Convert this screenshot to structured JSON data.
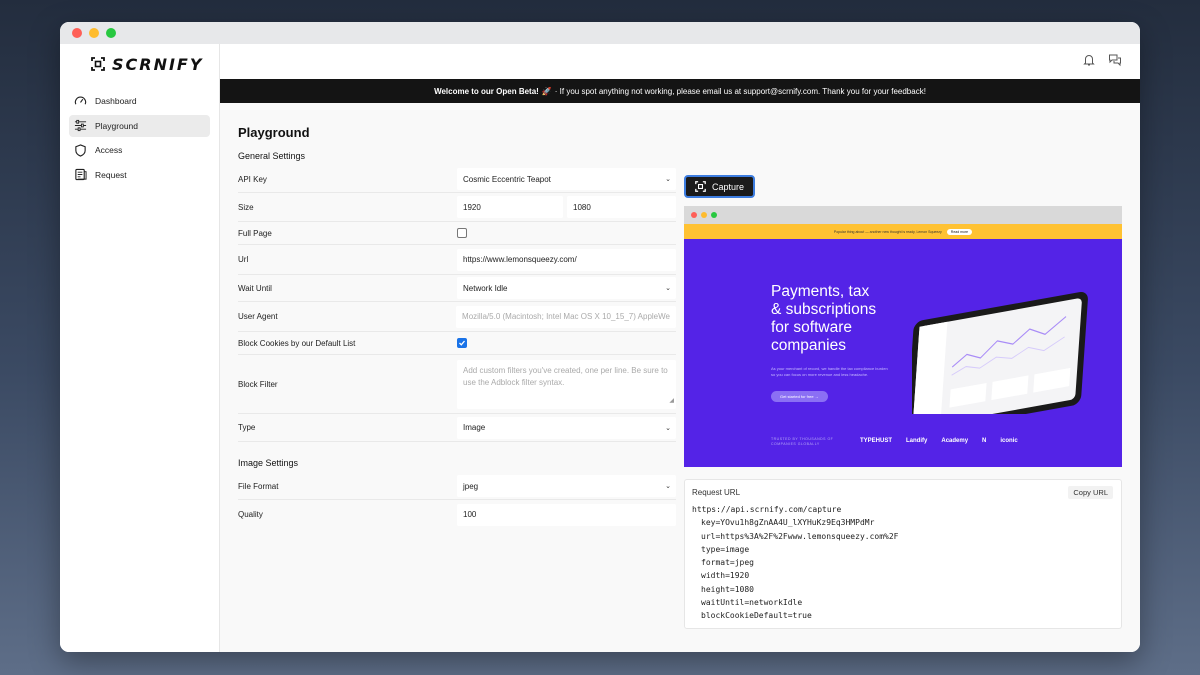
{
  "brand": {
    "name": "SCRNIFY"
  },
  "sidebar": {
    "items": [
      {
        "label": "Dashboard",
        "icon": "gauge-icon"
      },
      {
        "label": "Playground",
        "icon": "sliders-icon",
        "active": true
      },
      {
        "label": "Access",
        "icon": "shield-icon"
      },
      {
        "label": "Request",
        "icon": "scroll-icon"
      }
    ]
  },
  "topbar": {
    "icons": [
      "bell-icon",
      "chat-icon"
    ]
  },
  "banner": {
    "bold": "Welcome to our Open Beta!",
    "emoji": "🚀",
    "text": "· If you spot anything not working, please email us at support@scrnify.com. Thank you for your feedback!"
  },
  "page": {
    "title": "Playground"
  },
  "general": {
    "title": "General Settings",
    "api_key": {
      "label": "API Key",
      "value": "Cosmic Eccentric Teapot"
    },
    "size": {
      "label": "Size",
      "width": "1920",
      "height": "1080"
    },
    "full_page": {
      "label": "Full Page",
      "checked": false
    },
    "url": {
      "label": "Url",
      "value": "https://www.lemonsqueezy.com/"
    },
    "wait_until": {
      "label": "Wait Until",
      "value": "Network Idle"
    },
    "user_agent": {
      "label": "User Agent",
      "placeholder": "Mozilla/5.0 (Macintosh; Intel Mac OS X 10_15_7) AppleWe"
    },
    "block_cookies": {
      "label": "Block Cookies by our Default List",
      "checked": true
    },
    "block_filter": {
      "label": "Block Filter",
      "placeholder": "Add custom filters you've created, one per line. Be sure to use the Adblock filter syntax."
    },
    "type": {
      "label": "Type",
      "value": "Image"
    }
  },
  "image": {
    "title": "Image Settings",
    "file_format": {
      "label": "File Format",
      "value": "jpeg"
    },
    "quality": {
      "label": "Quality",
      "value": "100"
    }
  },
  "capture": {
    "label": "Capture"
  },
  "preview": {
    "announce": "Popular thing about — another new thought is ready, Lemon Squeezy",
    "announce_button": "Read more",
    "headline": [
      "Payments, tax",
      "& subscriptions",
      "for software",
      "companies"
    ],
    "subtext": "As your merchant of record, we handle the tax compliance burden so you can focus on more revenue and less headache.",
    "cta": "Get started for free  →",
    "trusted": [
      "TRUSTED BY THOUSANDS OF",
      "COMPANIES GLOBALLY"
    ],
    "logos": [
      "TYPEHUST",
      "Landify",
      "Academy",
      "N",
      "iconic"
    ]
  },
  "request": {
    "title": "Request URL",
    "copy_label": "Copy URL",
    "base": "https://api.scrnify.com/capture",
    "params": [
      "key=YOvu1h8gZnAA4U_lXYHuKz9Eq3HMPdMr",
      "url=https%3A%2F%2Fwww.lemonsqueezy.com%2F",
      "type=image",
      "format=jpeg",
      "width=1920",
      "height=1080",
      "waitUntil=networkIdle",
      "blockCookieDefault=true"
    ]
  },
  "colors": {
    "accent": "#3d7de0",
    "banner_bg": "#141414",
    "preview_purple": "#5423e7",
    "checkbox": "#1a73e8"
  }
}
